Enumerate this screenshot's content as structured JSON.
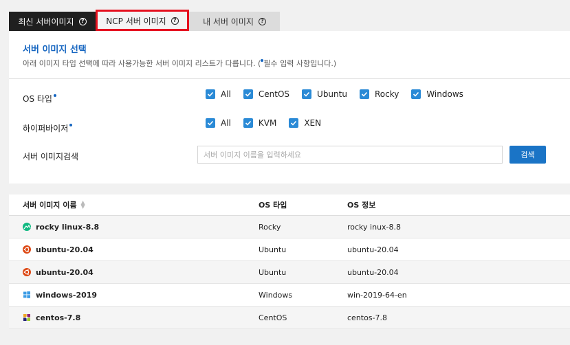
{
  "tabs": [
    {
      "label": "최신 서버이미지"
    },
    {
      "label": "NCP 서버 이미지"
    },
    {
      "label": "내 서버 이미지"
    }
  ],
  "panel": {
    "title": "서버 이미지 선택",
    "description_before": "아래 이미지 타입 선택에 따라 사용가능한 서버 이미지 리스트가 다릅니다. (",
    "description_after": "필수 입력 사항입니다.)"
  },
  "filters": {
    "os_label": "OS 타입",
    "os_options": [
      "All",
      "CentOS",
      "Ubuntu",
      "Rocky",
      "Windows"
    ],
    "hypervisor_label": "하이퍼바이저",
    "hypervisor_options": [
      "All",
      "KVM",
      "XEN"
    ],
    "search_label": "서버 이미지검색",
    "search_placeholder": "서버 이미지 이름을 입력하세요",
    "search_button": "검색"
  },
  "table": {
    "headers": [
      "서버 이미지 이름",
      "OS 타입",
      "OS 정보"
    ],
    "rows": [
      {
        "name": "rocky linux-8.8",
        "os": "Rocky",
        "info": "rocky inux-8.8",
        "icon": "rocky-icon"
      },
      {
        "name": "ubuntu-20.04",
        "os": "Ubuntu",
        "info": "ubuntu-20.04",
        "icon": "ubuntu-icon"
      },
      {
        "name": "ubuntu-20.04",
        "os": "Ubuntu",
        "info": "ubuntu-20.04",
        "icon": "ubuntu-icon"
      },
      {
        "name": "windows-2019",
        "os": "Windows",
        "info": "win-2019-64-en",
        "icon": "windows-icon"
      },
      {
        "name": "centos-7.8",
        "os": "CentOS",
        "info": "centos-7.8",
        "icon": "centos-icon"
      }
    ]
  },
  "colors": {
    "accent": "#1565c0",
    "checkbox": "#2a8ad6",
    "button": "#1a74c6",
    "highlight": "#e5101e"
  }
}
